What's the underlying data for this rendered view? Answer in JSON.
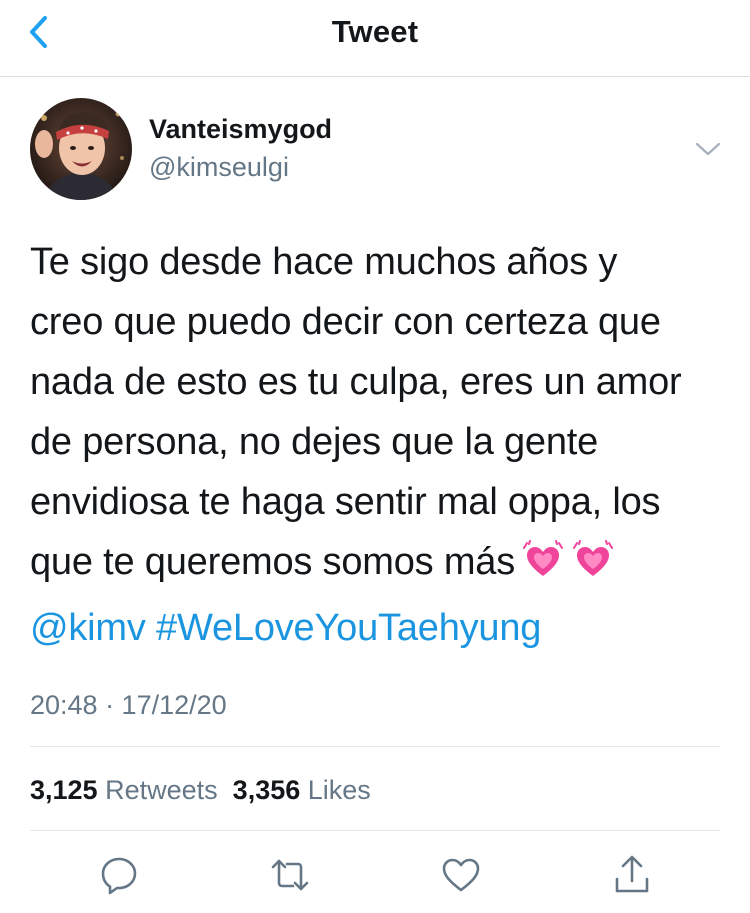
{
  "header": {
    "title": "Tweet",
    "back_icon": "chevron-left-icon"
  },
  "tweet": {
    "author": {
      "display_name": "Vanteismygod",
      "handle": "@kimseulgi"
    },
    "text_lines": [
      "Te sigo desde hace muchos años y",
      "creo que puedo decir con certeza que",
      "nada de esto es tu culpa, eres un amor",
      "de persona, no dejes que la gente",
      "envidiosa te haga sentir mal oppa, los",
      "que te queremos somos más"
    ],
    "emojis": [
      "growing-heart-emoji",
      "growing-heart-emoji"
    ],
    "mention": "@kimv",
    "hashtag": "#WeLoveYouTaehyung",
    "timestamp": "20:48 · 17/12/20"
  },
  "stats": {
    "retweets_count": "3,125",
    "retweets_label": "Retweets",
    "likes_count": "3,356",
    "likes_label": "Likes"
  },
  "actions": [
    "reply-icon",
    "retweet-icon",
    "like-icon",
    "share-icon"
  ],
  "colors": {
    "accent": "#1da1f2",
    "link": "#1b95e0",
    "secondary_text": "#657786",
    "primary_text": "#14171a",
    "divider": "#e1e8ed"
  }
}
